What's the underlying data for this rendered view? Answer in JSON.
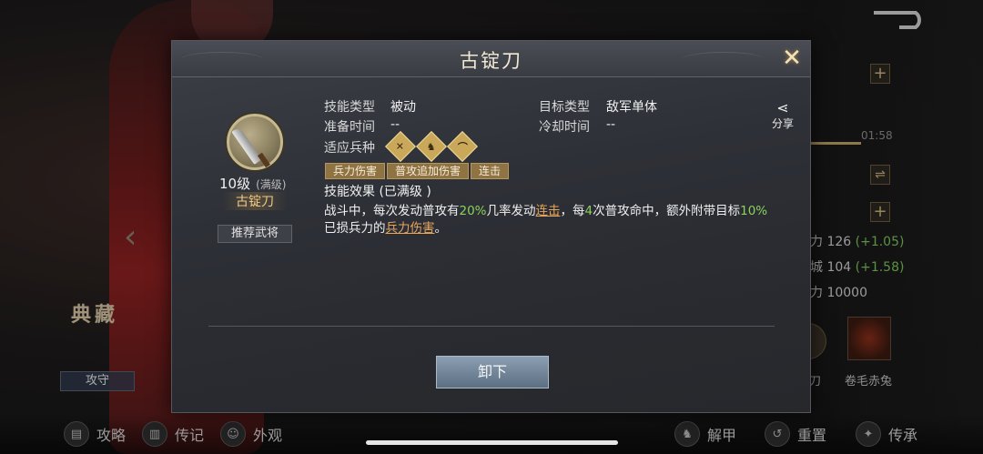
{
  "modal": {
    "title": "古锭刀",
    "close_label": "✕",
    "skill": {
      "level": "10级",
      "level_note": "(满级)",
      "name": "古锭刀",
      "recommend_label": "推荐武将"
    },
    "info": {
      "skill_type_label": "技能类型",
      "skill_type_value": "被动",
      "target_type_label": "目标类型",
      "target_type_value": "敌军单体",
      "prep_time_label": "准备时间",
      "prep_time_value": "--",
      "cooldown_label": "冷却时间",
      "cooldown_value": "--",
      "troop_label": "适应兵种"
    },
    "tags": [
      "兵力伤害",
      "普攻追加伤害",
      "连击"
    ],
    "share_label": "分享",
    "effect_title": "技能效果 (已满级 )",
    "effect": {
      "p1": "战斗中，每次发动普攻有",
      "pct1": "20%",
      "p2": "几率发动",
      "link1": "连击",
      "p3": "，每",
      "num1": "4",
      "p4": "次普攻命中，额外附带目标",
      "pct2": "10%",
      "p5": "已损兵力的",
      "link2": "兵力伤害",
      "p6": "。"
    },
    "unequip_label": "卸下"
  },
  "background": {
    "time": "01:58",
    "stats": [
      {
        "label": "力 126",
        "delta": "(+1.05)"
      },
      {
        "label": "城 104",
        "delta": "(+1.58)"
      },
      {
        "label": "力 10000",
        "delta": ""
      }
    ],
    "mount_left_label": "刀",
    "mount_label": "卷毛赤兔",
    "seal": "典藏",
    "attack_def": "攻守"
  },
  "bottom_bar": {
    "items": [
      "攻略",
      "传记",
      "外观",
      "解甲",
      "重置",
      "传承"
    ]
  }
}
